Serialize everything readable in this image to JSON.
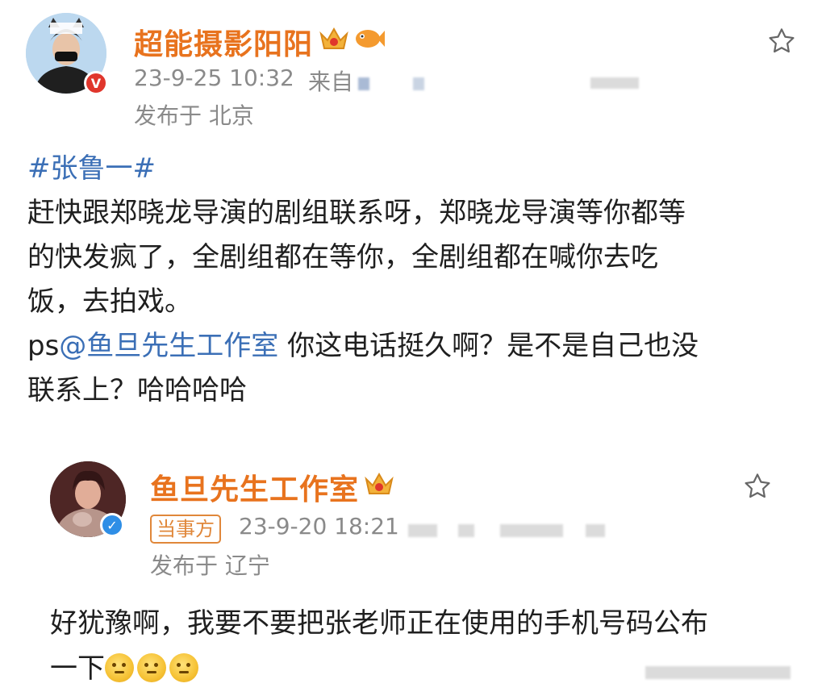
{
  "post": {
    "author": "超能摄影阳阳",
    "time": "23-9-25 10:32",
    "source_prefix": "来自",
    "location": "发布于 北京",
    "hashtag": "#张鲁一#",
    "lines": [
      "赶快跟郑晓龙导演的剧组联系呀，郑晓龙导演等你都等",
      "的快发疯了，全剧组都在等你，全剧组都在喊你去吃",
      "饭，去拍戏。"
    ],
    "ps_prefix": "ps",
    "mention": "@鱼旦先生工作室",
    "ps_rest": " 你这电话挺久啊？是不是自己也没",
    "ps_line2": "联系上？哈哈哈哈",
    "badge": "V",
    "colors": {
      "name": "#e8731e",
      "link": "#3b6fb6",
      "badge_red": "#e0362c",
      "badge_blue": "#2e8ee6"
    },
    "icons": [
      "crown-badge-icon",
      "fish-badge-icon",
      "star-icon"
    ]
  },
  "reply": {
    "author": "鱼旦先生工作室",
    "tag": "当事方",
    "time": "23-9-20 18:21",
    "location": "发布于 辽宁",
    "line1": "好犹豫啊，我要不要把张老师正在使用的手机号码公布",
    "line2_text": "一下",
    "emoji_count": 3,
    "badge": "✓",
    "icons": [
      "crown-badge-icon",
      "thinking-emoji-icon",
      "star-icon"
    ]
  }
}
